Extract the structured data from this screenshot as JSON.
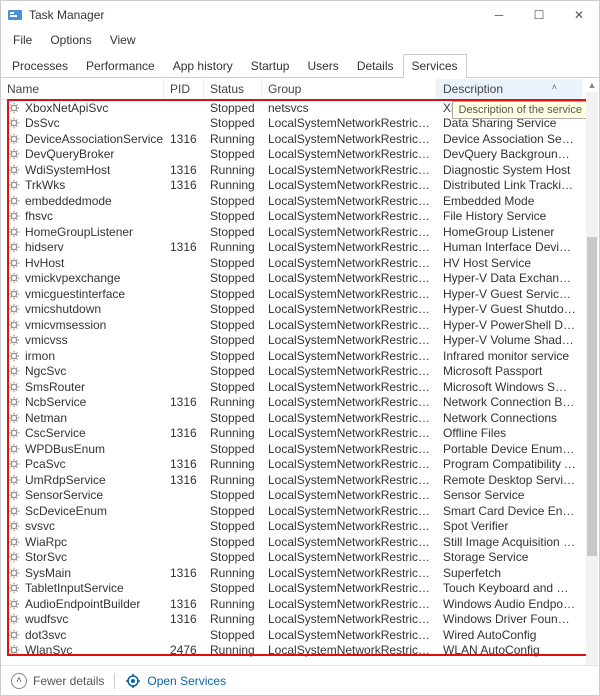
{
  "window": {
    "title": "Task Manager"
  },
  "menu": {
    "file": "File",
    "options": "Options",
    "view": "View"
  },
  "tabs": {
    "processes": "Processes",
    "performance": "Performance",
    "app_history": "App history",
    "startup": "Startup",
    "users": "Users",
    "details": "Details",
    "services": "Services"
  },
  "columns": {
    "name": "Name",
    "pid": "PID",
    "status": "Status",
    "group": "Group",
    "description": "Description"
  },
  "tooltip": "Description of the service",
  "footer": {
    "fewer": "Fewer details",
    "open_services": "Open Services"
  },
  "services": [
    {
      "name": "XboxNetApiSvc",
      "pid": "",
      "status": "Stopped",
      "group": "netsvcs",
      "desc": "Xbox Live Networking S"
    },
    {
      "name": "DsSvc",
      "pid": "",
      "status": "Stopped",
      "group": "LocalSystemNetworkRestricted",
      "desc": "Data Sharing Service"
    },
    {
      "name": "DeviceAssociationService",
      "pid": "1316",
      "status": "Running",
      "group": "LocalSystemNetworkRestricted",
      "desc": "Device Association Service"
    },
    {
      "name": "DevQueryBroker",
      "pid": "",
      "status": "Stopped",
      "group": "LocalSystemNetworkRestricted",
      "desc": "DevQuery Background Discovery Bro..."
    },
    {
      "name": "WdiSystemHost",
      "pid": "1316",
      "status": "Running",
      "group": "LocalSystemNetworkRestricted",
      "desc": "Diagnostic System Host"
    },
    {
      "name": "TrkWks",
      "pid": "1316",
      "status": "Running",
      "group": "LocalSystemNetworkRestricted",
      "desc": "Distributed Link Tracking Client"
    },
    {
      "name": "embeddedmode",
      "pid": "",
      "status": "Stopped",
      "group": "LocalSystemNetworkRestricted",
      "desc": "Embedded Mode"
    },
    {
      "name": "fhsvc",
      "pid": "",
      "status": "Stopped",
      "group": "LocalSystemNetworkRestricted",
      "desc": "File History Service"
    },
    {
      "name": "HomeGroupListener",
      "pid": "",
      "status": "Stopped",
      "group": "LocalSystemNetworkRestricted",
      "desc": "HomeGroup Listener"
    },
    {
      "name": "hidserv",
      "pid": "1316",
      "status": "Running",
      "group": "LocalSystemNetworkRestricted",
      "desc": "Human Interface Device Service"
    },
    {
      "name": "HvHost",
      "pid": "",
      "status": "Stopped",
      "group": "LocalSystemNetworkRestricted",
      "desc": "HV Host Service"
    },
    {
      "name": "vmickvpexchange",
      "pid": "",
      "status": "Stopped",
      "group": "LocalSystemNetworkRestricted",
      "desc": "Hyper-V Data Exchange Service"
    },
    {
      "name": "vmicguestinterface",
      "pid": "",
      "status": "Stopped",
      "group": "LocalSystemNetworkRestricted",
      "desc": "Hyper-V Guest Service Interface"
    },
    {
      "name": "vmicshutdown",
      "pid": "",
      "status": "Stopped",
      "group": "LocalSystemNetworkRestricted",
      "desc": "Hyper-V Guest Shutdown Service"
    },
    {
      "name": "vmicvmsession",
      "pid": "",
      "status": "Stopped",
      "group": "LocalSystemNetworkRestricted",
      "desc": "Hyper-V PowerShell Direct Service"
    },
    {
      "name": "vmicvss",
      "pid": "",
      "status": "Stopped",
      "group": "LocalSystemNetworkRestricted",
      "desc": "Hyper-V Volume Shadow Copy Requ..."
    },
    {
      "name": "irmon",
      "pid": "",
      "status": "Stopped",
      "group": "LocalSystemNetworkRestricted",
      "desc": "Infrared monitor service"
    },
    {
      "name": "NgcSvc",
      "pid": "",
      "status": "Stopped",
      "group": "LocalSystemNetworkRestricted",
      "desc": "Microsoft Passport"
    },
    {
      "name": "SmsRouter",
      "pid": "",
      "status": "Stopped",
      "group": "LocalSystemNetworkRestricted",
      "desc": "Microsoft Windows SMS Router Servi..."
    },
    {
      "name": "NcbService",
      "pid": "1316",
      "status": "Running",
      "group": "LocalSystemNetworkRestricted",
      "desc": "Network Connection Broker"
    },
    {
      "name": "Netman",
      "pid": "",
      "status": "Stopped",
      "group": "LocalSystemNetworkRestricted",
      "desc": "Network Connections"
    },
    {
      "name": "CscService",
      "pid": "1316",
      "status": "Running",
      "group": "LocalSystemNetworkRestricted",
      "desc": "Offline Files"
    },
    {
      "name": "WPDBusEnum",
      "pid": "",
      "status": "Stopped",
      "group": "LocalSystemNetworkRestricted",
      "desc": "Portable Device Enumerator Service"
    },
    {
      "name": "PcaSvc",
      "pid": "1316",
      "status": "Running",
      "group": "LocalSystemNetworkRestricted",
      "desc": "Program Compatibility Assistant Serv..."
    },
    {
      "name": "UmRdpService",
      "pid": "1316",
      "status": "Running",
      "group": "LocalSystemNetworkRestricted",
      "desc": "Remote Desktop Services UserMode ..."
    },
    {
      "name": "SensorService",
      "pid": "",
      "status": "Stopped",
      "group": "LocalSystemNetworkRestricted",
      "desc": "Sensor Service"
    },
    {
      "name": "ScDeviceEnum",
      "pid": "",
      "status": "Stopped",
      "group": "LocalSystemNetworkRestricted",
      "desc": "Smart Card Device Enumeration Servi..."
    },
    {
      "name": "svsvc",
      "pid": "",
      "status": "Stopped",
      "group": "LocalSystemNetworkRestricted",
      "desc": "Spot Verifier"
    },
    {
      "name": "WiaRpc",
      "pid": "",
      "status": "Stopped",
      "group": "LocalSystemNetworkRestricted",
      "desc": "Still Image Acquisition Events"
    },
    {
      "name": "StorSvc",
      "pid": "",
      "status": "Stopped",
      "group": "LocalSystemNetworkRestricted",
      "desc": "Storage Service"
    },
    {
      "name": "SysMain",
      "pid": "1316",
      "status": "Running",
      "group": "LocalSystemNetworkRestricted",
      "desc": "Superfetch"
    },
    {
      "name": "TabletInputService",
      "pid": "",
      "status": "Stopped",
      "group": "LocalSystemNetworkRestricted",
      "desc": "Touch Keyboard and Handwriting Pa..."
    },
    {
      "name": "AudioEndpointBuilder",
      "pid": "1316",
      "status": "Running",
      "group": "LocalSystemNetworkRestricted",
      "desc": "Windows Audio Endpoint Builder"
    },
    {
      "name": "wudfsvc",
      "pid": "1316",
      "status": "Running",
      "group": "LocalSystemNetworkRestricted",
      "desc": "Windows Driver Foundation - User-m..."
    },
    {
      "name": "dot3svc",
      "pid": "",
      "status": "Stopped",
      "group": "LocalSystemNetworkRestricted",
      "desc": "Wired AutoConfig"
    },
    {
      "name": "WlanSvc",
      "pid": "2476",
      "status": "Running",
      "group": "LocalSystemNetworkRestricted",
      "desc": "WLAN AutoConfig"
    }
  ]
}
